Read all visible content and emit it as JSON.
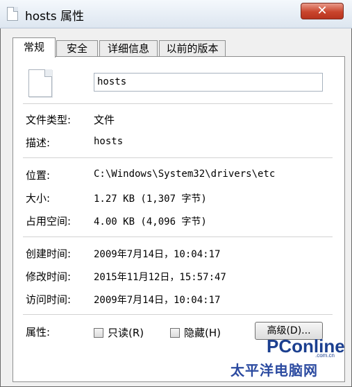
{
  "window": {
    "title": "hosts 属性",
    "close_label": "✕"
  },
  "tabs": [
    {
      "label": "常规"
    },
    {
      "label": "安全"
    },
    {
      "label": "详细信息"
    },
    {
      "label": "以前的版本"
    }
  ],
  "general": {
    "file_name": "hosts",
    "type_label": "文件类型:",
    "type_value": "文件",
    "desc_label": "描述:",
    "desc_value": "hosts",
    "location_label": "位置:",
    "location_value": "C:\\Windows\\System32\\drivers\\etc",
    "size_label": "大小:",
    "size_value": "1.27 KB (1,307 字节)",
    "disk_label": "占用空间:",
    "disk_value": "4.00 KB (4,096 字节)",
    "created_label": "创建时间:",
    "created_value": "2009年7月14日，10:04:17",
    "modified_label": "修改时间:",
    "modified_value": "2015年11月12日，15:57:47",
    "accessed_label": "访问时间:",
    "accessed_value": "2009年7月14日，10:04:17",
    "attr_label": "属性:",
    "readonly_label": "只读(R)",
    "hidden_label": "隐藏(H)",
    "advanced_label": "高级(D)..."
  },
  "watermark": {
    "logo": "PConline",
    "domain": ".com.cn",
    "chinese": "太平洋电脑网"
  }
}
